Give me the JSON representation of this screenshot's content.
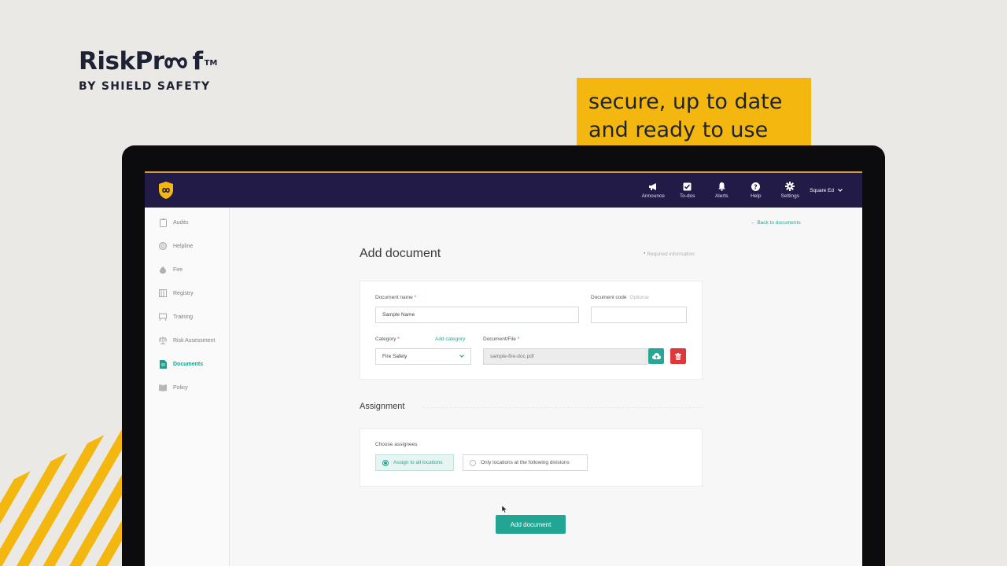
{
  "brand": {
    "name_part1": "RiskPr",
    "name_part2": "f",
    "tm": "TM",
    "byline": "BY SHIELD SAFETY"
  },
  "tagline": {
    "line1": "secure, up to date",
    "line2": "and ready to use"
  },
  "colors": {
    "accent_yellow": "#f4b70f",
    "header_navy": "#221b47",
    "teal": "#23a594",
    "danger": "#e0373b"
  },
  "header": {
    "nav": [
      {
        "label": "Announce",
        "icon": "megaphone-icon"
      },
      {
        "label": "To-dos",
        "icon": "checkbox-icon"
      },
      {
        "label": "Alerts",
        "icon": "bell-icon"
      },
      {
        "label": "Help",
        "icon": "help-icon"
      },
      {
        "label": "Settings",
        "icon": "gear-icon"
      }
    ],
    "user": "Square Ed"
  },
  "sidebar": {
    "items": [
      {
        "label": "Audits",
        "icon": "clipboard-icon"
      },
      {
        "label": "Helpline",
        "icon": "lifebuoy-icon"
      },
      {
        "label": "Fire",
        "icon": "flame-icon"
      },
      {
        "label": "Registry",
        "icon": "registry-icon"
      },
      {
        "label": "Training",
        "icon": "training-icon"
      },
      {
        "label": "Risk Assessment",
        "icon": "scales-icon"
      },
      {
        "label": "Documents",
        "icon": "document-icon",
        "active": true
      },
      {
        "label": "Policy",
        "icon": "book-icon"
      }
    ]
  },
  "main": {
    "back_link": "Back to documents",
    "title": "Add document",
    "required_note": "Required information",
    "document_name": {
      "label": "Document name",
      "value": "Sample Name"
    },
    "document_code": {
      "label": "Document code",
      "optional": "Optional",
      "value": ""
    },
    "category": {
      "label": "Category",
      "add_link": "Add category",
      "value": "Fire Safety"
    },
    "file": {
      "label": "Document/File",
      "value": "sample-fire-doc.pdf"
    },
    "assignment": {
      "title": "Assignment",
      "choose_label": "Choose assignees",
      "options": [
        {
          "label": "Assign to all locations",
          "selected": true
        },
        {
          "label": "Only locations at the following divisions",
          "selected": false
        }
      ]
    },
    "submit_label": "Add document"
  }
}
